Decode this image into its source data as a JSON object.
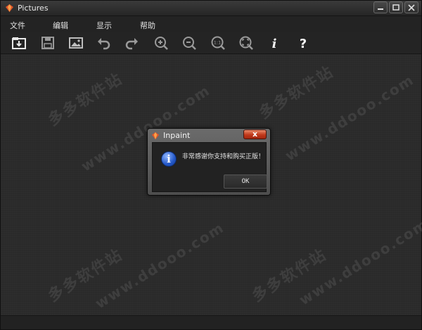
{
  "window": {
    "title": "Pictures"
  },
  "menu": [
    "文件",
    "编辑",
    "显示",
    "帮助"
  ],
  "toolbar": [
    {
      "name": "open-icon"
    },
    {
      "name": "save-icon"
    },
    {
      "name": "image-icon"
    },
    {
      "name": "undo-icon"
    },
    {
      "name": "redo-icon"
    },
    {
      "name": "zoom-in-icon"
    },
    {
      "name": "zoom-out-icon"
    },
    {
      "name": "actual-size-icon"
    },
    {
      "name": "fit-to-window-icon"
    },
    {
      "name": "info-icon"
    },
    {
      "name": "help-icon"
    }
  ],
  "toolbar_glyphs": {
    "actual_size": "1:1",
    "info": "i",
    "help": "?"
  },
  "dialog": {
    "title": "Inpaint",
    "close": "x",
    "info_glyph": "i",
    "message": "非常感谢你支持和购买正版！",
    "ok_label": "OK"
  },
  "watermark": [
    "多多软件站",
    "www.ddooo.com"
  ],
  "colors": {
    "accent_close": "#c0391b",
    "info_blue": "#2357c7",
    "background": "#2b2b2b"
  }
}
